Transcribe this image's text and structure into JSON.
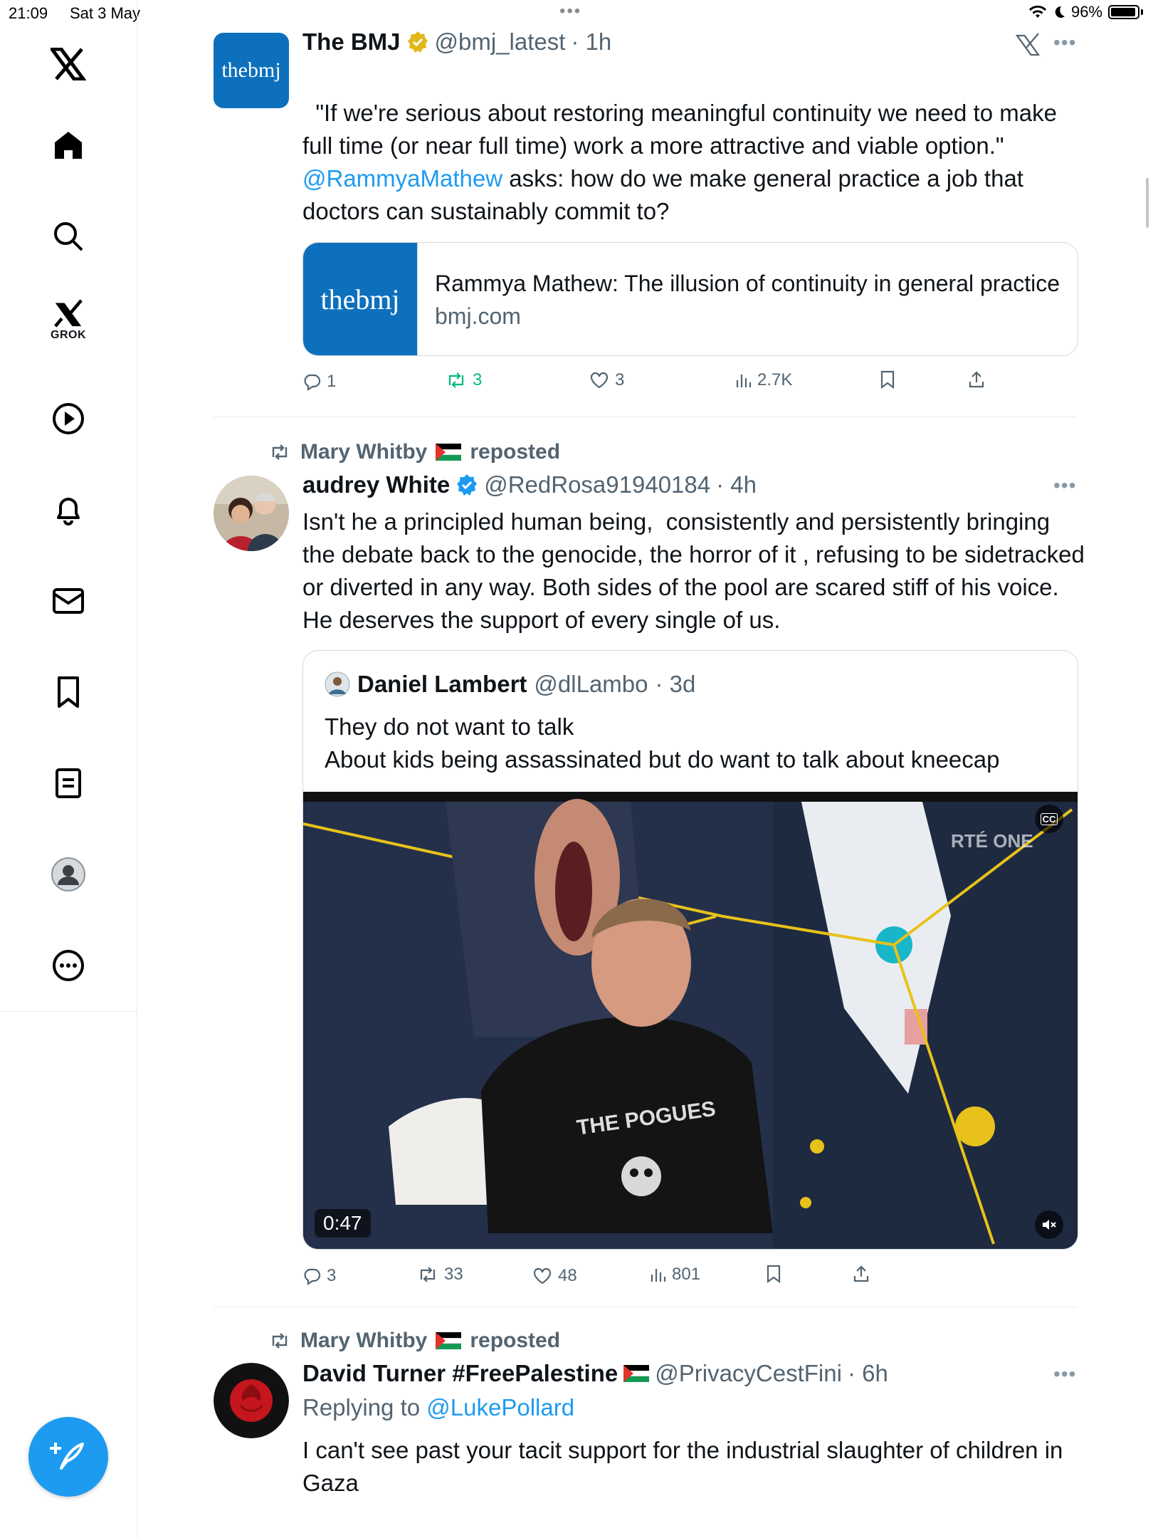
{
  "status_bar": {
    "time": "21:09",
    "date": "Sat 3 May",
    "battery": "96%"
  },
  "sidebar": {
    "items": [
      {
        "name": "x-logo-icon"
      },
      {
        "name": "home-icon"
      },
      {
        "name": "search-icon"
      },
      {
        "name": "grok-icon",
        "label": "GROK"
      },
      {
        "name": "video-icon"
      },
      {
        "name": "notifications-icon"
      },
      {
        "name": "messages-icon"
      },
      {
        "name": "bookmarks-icon"
      },
      {
        "name": "lists-icon"
      },
      {
        "name": "profile-icon"
      },
      {
        "name": "more-icon"
      }
    ]
  },
  "tweets": [
    {
      "name": "The BMJ",
      "handle": "@bmj_latest",
      "time": "· 1h",
      "avatar_text": "thebmj",
      "text_line1": "\"If we're serious about restoring meaningful continuity we need to make full time (or near full time) work a more attractive and viable option.\"",
      "mention": "@RammyaMathew",
      "text_line2": " asks: how do we make general practice a job that doctors can sustainably commit to?",
      "card": {
        "title": "Rammya Mathew: The illusion of continuity in general practice",
        "domain": "bmj.com",
        "image_text": "thebmj"
      },
      "actions": {
        "replies": "1",
        "reposts": "3",
        "likes": "3",
        "views": "2.7K"
      }
    },
    {
      "repost_by": "Mary Whitby",
      "repost_label": "reposted",
      "name": "audrey White",
      "handle": "@RedRosa91940184",
      "time": "· 4h",
      "text": "Isn't he a principled human being,  consistently and persistently bringing the debate back to the genocide, the horror of it , refusing to be sidetracked or diverted in any way. Both sides of the pool are scared stiff of his voice. He deserves the support of every single of us.",
      "quote": {
        "name": "Daniel Lambert",
        "handle": "@dlLambo",
        "time": "· 3d",
        "text": "They do not want to talk\nAbout kids being assassinated but do want to talk about kneecap",
        "video": {
          "duration": "0:47",
          "watermark": "RTÉ ONE",
          "cc": "CC",
          "shirt_text": "THE POGUES"
        }
      },
      "actions": {
        "replies": "3",
        "reposts": "33",
        "likes": "48",
        "views": "801"
      }
    },
    {
      "repost_by": "Mary Whitby",
      "repost_label": "reposted",
      "name": "David Turner #FreePalestine",
      "handle": "@PrivacyCestFini",
      "time": "· 6h",
      "replying_prefix": "Replying to ",
      "replying_to": "@LukePollard",
      "text": "I can't see past your tacit support for the industrial slaughter of children in Gaza"
    }
  ]
}
